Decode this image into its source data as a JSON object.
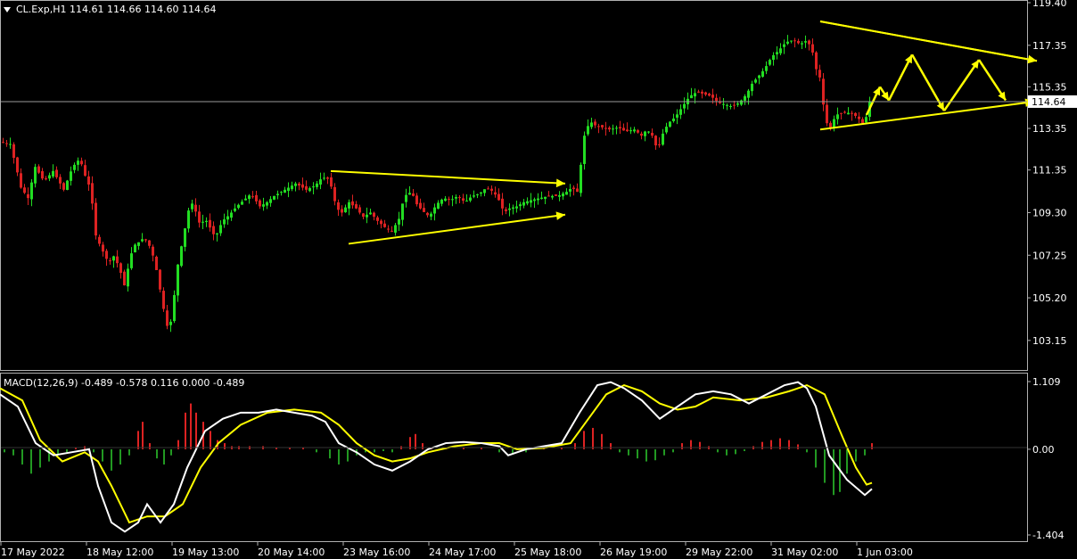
{
  "main_panel": {
    "header": "CL.Exp,H1  114.61 114.66 114.60 114.64",
    "y_ticks": [
      "119.40",
      "117.35",
      "115.35",
      "113.35",
      "111.35",
      "109.30",
      "107.25",
      "105.20",
      "103.15"
    ],
    "y_min": 102.5,
    "y_max": 119.4,
    "current_price_label": "114.64"
  },
  "macd_panel": {
    "header": "MACD(12,26,9) -0.489 -0.578 0.116 0.000 -0.489",
    "y_ticks": [
      "1.109",
      "0.00",
      "-1.404"
    ],
    "y_min": -1.404,
    "y_max": 1.109
  },
  "x_ticks": [
    "17 May 2022",
    "18 May 12:00",
    "19 May 13:00",
    "20 May 14:00",
    "23 May 16:00",
    "24 May 17:00",
    "25 May 18:00",
    "26 May 19:00",
    "29 May 22:00",
    "31 May 02:00",
    "1 Jun 03:00"
  ],
  "colors": {
    "background": "#000000",
    "bull_candle": "#22dd22",
    "bear_candle": "#dd2222",
    "annotation": "#ffff00",
    "macd_line": "#ffffff",
    "signal_line": "#ffff00",
    "hist_pos": "#dd2222",
    "hist_neg": "#229922",
    "grid": "#808080"
  },
  "chart_data": {
    "type": "candlestick",
    "symbol": "CL.Exp",
    "timeframe": "H1",
    "close_path": [
      [
        0,
        112.7
      ],
      [
        10,
        112.6
      ],
      [
        16,
        111.6
      ],
      [
        22,
        110.5
      ],
      [
        30,
        110.0
      ],
      [
        38,
        111.5
      ],
      [
        48,
        110.8
      ],
      [
        58,
        111.3
      ],
      [
        70,
        110.4
      ],
      [
        80,
        111.5
      ],
      [
        88,
        111.9
      ],
      [
        96,
        110.8
      ],
      [
        100,
        110.5
      ],
      [
        106,
        108.2
      ],
      [
        112,
        107.6
      ],
      [
        120,
        106.9
      ],
      [
        126,
        107.2
      ],
      [
        132,
        106.7
      ],
      [
        138,
        105.8
      ],
      [
        143,
        106.8
      ],
      [
        148,
        107.7
      ],
      [
        155,
        107.9
      ],
      [
        160,
        108.1
      ],
      [
        166,
        107.7
      ],
      [
        172,
        107.0
      ],
      [
        178,
        105.6
      ],
      [
        184,
        104.2
      ],
      [
        188,
        103.5
      ],
      [
        192,
        104.6
      ],
      [
        198,
        106.8
      ],
      [
        203,
        107.9
      ],
      [
        210,
        109.4
      ],
      [
        216,
        109.9
      ],
      [
        220,
        108.8
      ],
      [
        230,
        108.9
      ],
      [
        240,
        108.1
      ],
      [
        248,
        108.9
      ],
      [
        256,
        109.2
      ],
      [
        264,
        109.6
      ],
      [
        272,
        109.9
      ],
      [
        280,
        110.2
      ],
      [
        290,
        109.6
      ],
      [
        298,
        109.8
      ],
      [
        306,
        110.1
      ],
      [
        318,
        110.4
      ],
      [
        330,
        110.7
      ],
      [
        342,
        110.4
      ],
      [
        352,
        110.6
      ],
      [
        360,
        111.0
      ],
      [
        368,
        110.9
      ],
      [
        376,
        109.5
      ],
      [
        382,
        109.3
      ],
      [
        390,
        109.8
      ],
      [
        398,
        109.5
      ],
      [
        406,
        109.1
      ],
      [
        414,
        109.3
      ],
      [
        422,
        108.9
      ],
      [
        430,
        108.6
      ],
      [
        438,
        108.4
      ],
      [
        446,
        109.0
      ],
      [
        452,
        110.1
      ],
      [
        460,
        110.3
      ],
      [
        466,
        109.7
      ],
      [
        472,
        109.4
      ],
      [
        480,
        109.1
      ],
      [
        488,
        109.7
      ],
      [
        496,
        110.0
      ],
      [
        504,
        109.9
      ],
      [
        512,
        110.1
      ],
      [
        520,
        109.8
      ],
      [
        528,
        110.1
      ],
      [
        536,
        110.2
      ],
      [
        544,
        110.5
      ],
      [
        552,
        110.3
      ],
      [
        558,
        109.9
      ],
      [
        564,
        109.3
      ],
      [
        570,
        109.5
      ],
      [
        578,
        109.6
      ],
      [
        586,
        109.8
      ],
      [
        594,
        109.9
      ],
      [
        604,
        110.0
      ],
      [
        614,
        110.1
      ],
      [
        624,
        110.1
      ],
      [
        634,
        110.3
      ],
      [
        640,
        110.5
      ],
      [
        646,
        110.3
      ],
      [
        650,
        111.6
      ],
      [
        654,
        113.0
      ],
      [
        660,
        113.7
      ],
      [
        666,
        113.5
      ],
      [
        674,
        113.4
      ],
      [
        682,
        113.3
      ],
      [
        692,
        113.4
      ],
      [
        700,
        113.2
      ],
      [
        710,
        113.3
      ],
      [
        718,
        113.0
      ],
      [
        724,
        113.3
      ],
      [
        730,
        113.0
      ],
      [
        736,
        112.3
      ],
      [
        742,
        113.1
      ],
      [
        748,
        113.6
      ],
      [
        756,
        113.9
      ],
      [
        764,
        114.4
      ],
      [
        772,
        114.9
      ],
      [
        780,
        115.1
      ],
      [
        788,
        115.0
      ],
      [
        796,
        114.9
      ],
      [
        804,
        114.6
      ],
      [
        812,
        114.5
      ],
      [
        820,
        114.4
      ],
      [
        828,
        114.6
      ],
      [
        836,
        115.0
      ],
      [
        842,
        115.5
      ],
      [
        848,
        115.8
      ],
      [
        856,
        116.2
      ],
      [
        864,
        116.8
      ],
      [
        872,
        117.1
      ],
      [
        880,
        117.5
      ],
      [
        888,
        117.6
      ],
      [
        896,
        117.4
      ],
      [
        904,
        117.6
      ],
      [
        910,
        117.0
      ],
      [
        914,
        116.2
      ],
      [
        918,
        115.8
      ],
      [
        922,
        114.5
      ],
      [
        926,
        113.6
      ],
      [
        930,
        113.4
      ],
      [
        936,
        114.0
      ],
      [
        944,
        114.1
      ],
      [
        952,
        114.1
      ],
      [
        960,
        113.9
      ],
      [
        966,
        113.6
      ],
      [
        970,
        113.9
      ],
      [
        974,
        114.64
      ]
    ],
    "annotations": [
      {
        "type": "arrow",
        "from": [
          371,
          111.3
        ],
        "to": [
          634,
          110.7
        ]
      },
      {
        "type": "arrow",
        "from": [
          391,
          107.8
        ],
        "to": [
          634,
          109.2
        ]
      },
      {
        "type": "line",
        "from": [
          920,
          118.5
        ],
        "to": [
          1163,
          116.6
        ]
      },
      {
        "type": "arrow",
        "from": [
          920,
          118.5
        ],
        "to": [
          1163,
          116.6
        ]
      },
      {
        "type": "arrow",
        "from": [
          920,
          113.3
        ],
        "to": [
          1160,
          114.64
        ]
      },
      {
        "type": "zigzag",
        "points": [
          [
            972,
            114.0
          ],
          [
            987,
            115.35
          ],
          [
            997,
            114.7
          ],
          [
            1023,
            116.9
          ],
          [
            1059,
            114.2
          ],
          [
            1098,
            116.65
          ],
          [
            1128,
            114.7
          ]
        ]
      }
    ],
    "macd_path": [
      [
        0,
        0.9
      ],
      [
        20,
        0.7
      ],
      [
        40,
        0.1
      ],
      [
        60,
        -0.1
      ],
      [
        80,
        -0.05
      ],
      [
        100,
        0.0
      ],
      [
        110,
        -0.6
      ],
      [
        125,
        -1.2
      ],
      [
        140,
        -1.35
      ],
      [
        155,
        -1.2
      ],
      [
        165,
        -0.9
      ],
      [
        180,
        -1.2
      ],
      [
        195,
        -0.9
      ],
      [
        210,
        -0.3
      ],
      [
        230,
        0.3
      ],
      [
        250,
        0.5
      ],
      [
        270,
        0.6
      ],
      [
        290,
        0.6
      ],
      [
        310,
        0.65
      ],
      [
        330,
        0.6
      ],
      [
        350,
        0.55
      ],
      [
        365,
        0.45
      ],
      [
        380,
        0.1
      ],
      [
        400,
        -0.05
      ],
      [
        420,
        -0.25
      ],
      [
        440,
        -0.35
      ],
      [
        460,
        -0.2
      ],
      [
        480,
        0.0
      ],
      [
        500,
        0.1
      ],
      [
        520,
        0.12
      ],
      [
        540,
        0.1
      ],
      [
        560,
        0.05
      ],
      [
        570,
        -0.1
      ],
      [
        590,
        0.0
      ],
      [
        610,
        0.05
      ],
      [
        630,
        0.1
      ],
      [
        650,
        0.6
      ],
      [
        670,
        1.05
      ],
      [
        685,
        1.1
      ],
      [
        700,
        1.0
      ],
      [
        720,
        0.8
      ],
      [
        740,
        0.5
      ],
      [
        760,
        0.7
      ],
      [
        780,
        0.9
      ],
      [
        800,
        0.95
      ],
      [
        820,
        0.9
      ],
      [
        840,
        0.75
      ],
      [
        860,
        0.9
      ],
      [
        880,
        1.05
      ],
      [
        895,
        1.1
      ],
      [
        905,
        1.0
      ],
      [
        915,
        0.7
      ],
      [
        930,
        -0.1
      ],
      [
        950,
        -0.5
      ],
      [
        970,
        -0.75
      ],
      [
        978,
        -0.65
      ]
    ],
    "signal_path": [
      [
        0,
        1.0
      ],
      [
        25,
        0.8
      ],
      [
        45,
        0.15
      ],
      [
        70,
        -0.2
      ],
      [
        95,
        -0.05
      ],
      [
        110,
        -0.2
      ],
      [
        125,
        -0.6
      ],
      [
        145,
        -1.2
      ],
      [
        165,
        -1.1
      ],
      [
        185,
        -1.1
      ],
      [
        205,
        -0.9
      ],
      [
        225,
        -0.3
      ],
      [
        245,
        0.1
      ],
      [
        270,
        0.4
      ],
      [
        300,
        0.6
      ],
      [
        330,
        0.65
      ],
      [
        360,
        0.6
      ],
      [
        380,
        0.4
      ],
      [
        400,
        0.1
      ],
      [
        420,
        -0.1
      ],
      [
        440,
        -0.2
      ],
      [
        460,
        -0.15
      ],
      [
        480,
        -0.05
      ],
      [
        510,
        0.05
      ],
      [
        540,
        0.1
      ],
      [
        560,
        0.1
      ],
      [
        580,
        0.0
      ],
      [
        610,
        0.02
      ],
      [
        640,
        0.1
      ],
      [
        660,
        0.5
      ],
      [
        680,
        0.9
      ],
      [
        700,
        1.05
      ],
      [
        720,
        0.95
      ],
      [
        740,
        0.75
      ],
      [
        760,
        0.65
      ],
      [
        780,
        0.7
      ],
      [
        800,
        0.85
      ],
      [
        830,
        0.8
      ],
      [
        860,
        0.85
      ],
      [
        885,
        0.95
      ],
      [
        905,
        1.05
      ],
      [
        925,
        0.9
      ],
      [
        945,
        0.2
      ],
      [
        960,
        -0.3
      ],
      [
        972,
        -0.58
      ],
      [
        978,
        -0.55
      ]
    ],
    "hist_bars": [
      [
        5,
        -0.05
      ],
      [
        15,
        -0.1
      ],
      [
        25,
        -0.25
      ],
      [
        35,
        -0.4
      ],
      [
        45,
        -0.3
      ],
      [
        55,
        -0.2
      ],
      [
        65,
        -0.1
      ],
      [
        75,
        -0.05
      ],
      [
        85,
        0.03
      ],
      [
        95,
        0.05
      ],
      [
        105,
        -0.05
      ],
      [
        115,
        -0.2
      ],
      [
        125,
        -0.35
      ],
      [
        135,
        -0.25
      ],
      [
        145,
        -0.1
      ],
      [
        155,
        0.3
      ],
      [
        160,
        0.45
      ],
      [
        168,
        0.1
      ],
      [
        176,
        -0.15
      ],
      [
        184,
        -0.25
      ],
      [
        192,
        -0.1
      ],
      [
        200,
        0.15
      ],
      [
        208,
        0.6
      ],
      [
        214,
        0.75
      ],
      [
        220,
        0.6
      ],
      [
        228,
        0.45
      ],
      [
        236,
        0.3
      ],
      [
        244,
        0.15
      ],
      [
        252,
        0.1
      ],
      [
        260,
        0.05
      ],
      [
        268,
        0.05
      ],
      [
        280,
        0.05
      ],
      [
        295,
        0.05
      ],
      [
        310,
        0.03
      ],
      [
        325,
        0.02
      ],
      [
        340,
        0.03
      ],
      [
        355,
        -0.05
      ],
      [
        370,
        -0.15
      ],
      [
        380,
        -0.25
      ],
      [
        390,
        -0.2
      ],
      [
        400,
        -0.1
      ],
      [
        410,
        -0.05
      ],
      [
        420,
        -0.05
      ],
      [
        430,
        -0.03
      ],
      [
        440,
        -0.05
      ],
      [
        450,
        0.05
      ],
      [
        460,
        0.2
      ],
      [
        466,
        0.25
      ],
      [
        474,
        0.1
      ],
      [
        484,
        0.03
      ],
      [
        500,
        0.02
      ],
      [
        520,
        0.02
      ],
      [
        540,
        0.02
      ],
      [
        560,
        -0.05
      ],
      [
        575,
        -0.08
      ],
      [
        590,
        -0.05
      ],
      [
        610,
        0.02
      ],
      [
        630,
        0.03
      ],
      [
        645,
        0.1
      ],
      [
        655,
        0.3
      ],
      [
        665,
        0.35
      ],
      [
        675,
        0.25
      ],
      [
        685,
        0.1
      ],
      [
        695,
        -0.05
      ],
      [
        705,
        -0.1
      ],
      [
        715,
        -0.15
      ],
      [
        725,
        -0.2
      ],
      [
        735,
        -0.18
      ],
      [
        745,
        -0.1
      ],
      [
        755,
        -0.05
      ],
      [
        765,
        0.1
      ],
      [
        775,
        0.15
      ],
      [
        785,
        0.12
      ],
      [
        795,
        0.05
      ],
      [
        805,
        -0.05
      ],
      [
        815,
        -0.1
      ],
      [
        825,
        -0.08
      ],
      [
        835,
        -0.03
      ],
      [
        845,
        0.05
      ],
      [
        855,
        0.12
      ],
      [
        865,
        0.15
      ],
      [
        875,
        0.18
      ],
      [
        885,
        0.15
      ],
      [
        895,
        0.08
      ],
      [
        905,
        -0.05
      ],
      [
        915,
        -0.3
      ],
      [
        925,
        -0.55
      ],
      [
        935,
        -0.75
      ],
      [
        942,
        -0.7
      ],
      [
        950,
        -0.4
      ],
      [
        960,
        -0.2
      ],
      [
        970,
        -0.1
      ],
      [
        978,
        0.1
      ]
    ]
  }
}
